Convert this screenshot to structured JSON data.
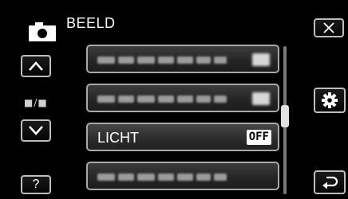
{
  "header": {
    "title": "BEELD",
    "icon": "camera-icon"
  },
  "left_panel": {
    "up_button_icon": "chevron-up-icon",
    "mode_indicator": "■/■",
    "down_button_icon": "chevron-down-icon",
    "help_label": "?"
  },
  "right_panel": {
    "close_icon": "close-icon",
    "settings_icon": "gear-icon",
    "back_icon": "return-icon"
  },
  "menu": {
    "items": [
      {
        "label": "",
        "value": ""
      },
      {
        "label": "",
        "value": ""
      },
      {
        "label": "LICHT",
        "value": "OFF"
      },
      {
        "label": "",
        "value": ""
      }
    ]
  },
  "scrollbar": {
    "position_fraction": 0.45
  },
  "colors": {
    "background": "#000000",
    "item_border": "#a8a8a8",
    "text": "#ffffff"
  }
}
